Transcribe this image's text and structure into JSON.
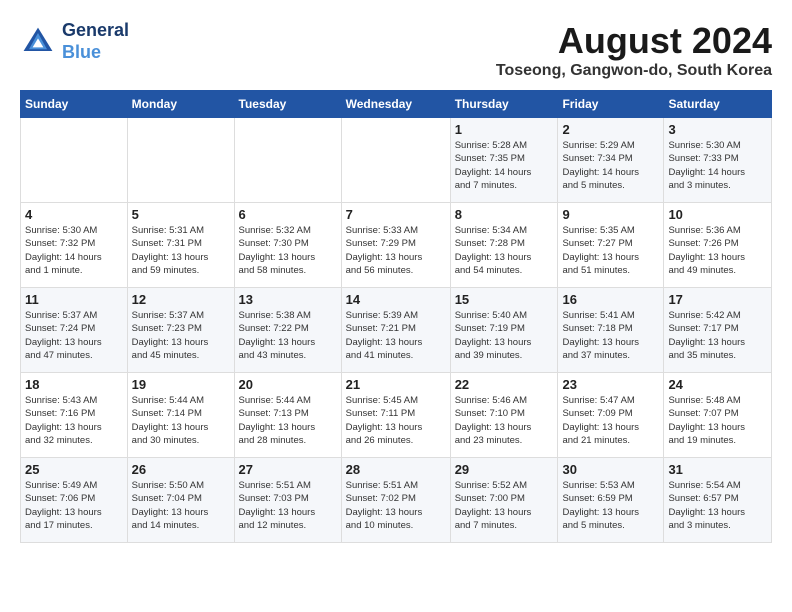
{
  "header": {
    "logo_line1": "General",
    "logo_line2": "Blue",
    "month_year": "August 2024",
    "location": "Toseong, Gangwon-do, South Korea"
  },
  "days_of_week": [
    "Sunday",
    "Monday",
    "Tuesday",
    "Wednesday",
    "Thursday",
    "Friday",
    "Saturday"
  ],
  "weeks": [
    [
      {
        "day": "",
        "info": ""
      },
      {
        "day": "",
        "info": ""
      },
      {
        "day": "",
        "info": ""
      },
      {
        "day": "",
        "info": ""
      },
      {
        "day": "1",
        "info": "Sunrise: 5:28 AM\nSunset: 7:35 PM\nDaylight: 14 hours\nand 7 minutes."
      },
      {
        "day": "2",
        "info": "Sunrise: 5:29 AM\nSunset: 7:34 PM\nDaylight: 14 hours\nand 5 minutes."
      },
      {
        "day": "3",
        "info": "Sunrise: 5:30 AM\nSunset: 7:33 PM\nDaylight: 14 hours\nand 3 minutes."
      }
    ],
    [
      {
        "day": "4",
        "info": "Sunrise: 5:30 AM\nSunset: 7:32 PM\nDaylight: 14 hours\nand 1 minute."
      },
      {
        "day": "5",
        "info": "Sunrise: 5:31 AM\nSunset: 7:31 PM\nDaylight: 13 hours\nand 59 minutes."
      },
      {
        "day": "6",
        "info": "Sunrise: 5:32 AM\nSunset: 7:30 PM\nDaylight: 13 hours\nand 58 minutes."
      },
      {
        "day": "7",
        "info": "Sunrise: 5:33 AM\nSunset: 7:29 PM\nDaylight: 13 hours\nand 56 minutes."
      },
      {
        "day": "8",
        "info": "Sunrise: 5:34 AM\nSunset: 7:28 PM\nDaylight: 13 hours\nand 54 minutes."
      },
      {
        "day": "9",
        "info": "Sunrise: 5:35 AM\nSunset: 7:27 PM\nDaylight: 13 hours\nand 51 minutes."
      },
      {
        "day": "10",
        "info": "Sunrise: 5:36 AM\nSunset: 7:26 PM\nDaylight: 13 hours\nand 49 minutes."
      }
    ],
    [
      {
        "day": "11",
        "info": "Sunrise: 5:37 AM\nSunset: 7:24 PM\nDaylight: 13 hours\nand 47 minutes."
      },
      {
        "day": "12",
        "info": "Sunrise: 5:37 AM\nSunset: 7:23 PM\nDaylight: 13 hours\nand 45 minutes."
      },
      {
        "day": "13",
        "info": "Sunrise: 5:38 AM\nSunset: 7:22 PM\nDaylight: 13 hours\nand 43 minutes."
      },
      {
        "day": "14",
        "info": "Sunrise: 5:39 AM\nSunset: 7:21 PM\nDaylight: 13 hours\nand 41 minutes."
      },
      {
        "day": "15",
        "info": "Sunrise: 5:40 AM\nSunset: 7:19 PM\nDaylight: 13 hours\nand 39 minutes."
      },
      {
        "day": "16",
        "info": "Sunrise: 5:41 AM\nSunset: 7:18 PM\nDaylight: 13 hours\nand 37 minutes."
      },
      {
        "day": "17",
        "info": "Sunrise: 5:42 AM\nSunset: 7:17 PM\nDaylight: 13 hours\nand 35 minutes."
      }
    ],
    [
      {
        "day": "18",
        "info": "Sunrise: 5:43 AM\nSunset: 7:16 PM\nDaylight: 13 hours\nand 32 minutes."
      },
      {
        "day": "19",
        "info": "Sunrise: 5:44 AM\nSunset: 7:14 PM\nDaylight: 13 hours\nand 30 minutes."
      },
      {
        "day": "20",
        "info": "Sunrise: 5:44 AM\nSunset: 7:13 PM\nDaylight: 13 hours\nand 28 minutes."
      },
      {
        "day": "21",
        "info": "Sunrise: 5:45 AM\nSunset: 7:11 PM\nDaylight: 13 hours\nand 26 minutes."
      },
      {
        "day": "22",
        "info": "Sunrise: 5:46 AM\nSunset: 7:10 PM\nDaylight: 13 hours\nand 23 minutes."
      },
      {
        "day": "23",
        "info": "Sunrise: 5:47 AM\nSunset: 7:09 PM\nDaylight: 13 hours\nand 21 minutes."
      },
      {
        "day": "24",
        "info": "Sunrise: 5:48 AM\nSunset: 7:07 PM\nDaylight: 13 hours\nand 19 minutes."
      }
    ],
    [
      {
        "day": "25",
        "info": "Sunrise: 5:49 AM\nSunset: 7:06 PM\nDaylight: 13 hours\nand 17 minutes."
      },
      {
        "day": "26",
        "info": "Sunrise: 5:50 AM\nSunset: 7:04 PM\nDaylight: 13 hours\nand 14 minutes."
      },
      {
        "day": "27",
        "info": "Sunrise: 5:51 AM\nSunset: 7:03 PM\nDaylight: 13 hours\nand 12 minutes."
      },
      {
        "day": "28",
        "info": "Sunrise: 5:51 AM\nSunset: 7:02 PM\nDaylight: 13 hours\nand 10 minutes."
      },
      {
        "day": "29",
        "info": "Sunrise: 5:52 AM\nSunset: 7:00 PM\nDaylight: 13 hours\nand 7 minutes."
      },
      {
        "day": "30",
        "info": "Sunrise: 5:53 AM\nSunset: 6:59 PM\nDaylight: 13 hours\nand 5 minutes."
      },
      {
        "day": "31",
        "info": "Sunrise: 5:54 AM\nSunset: 6:57 PM\nDaylight: 13 hours\nand 3 minutes."
      }
    ]
  ]
}
